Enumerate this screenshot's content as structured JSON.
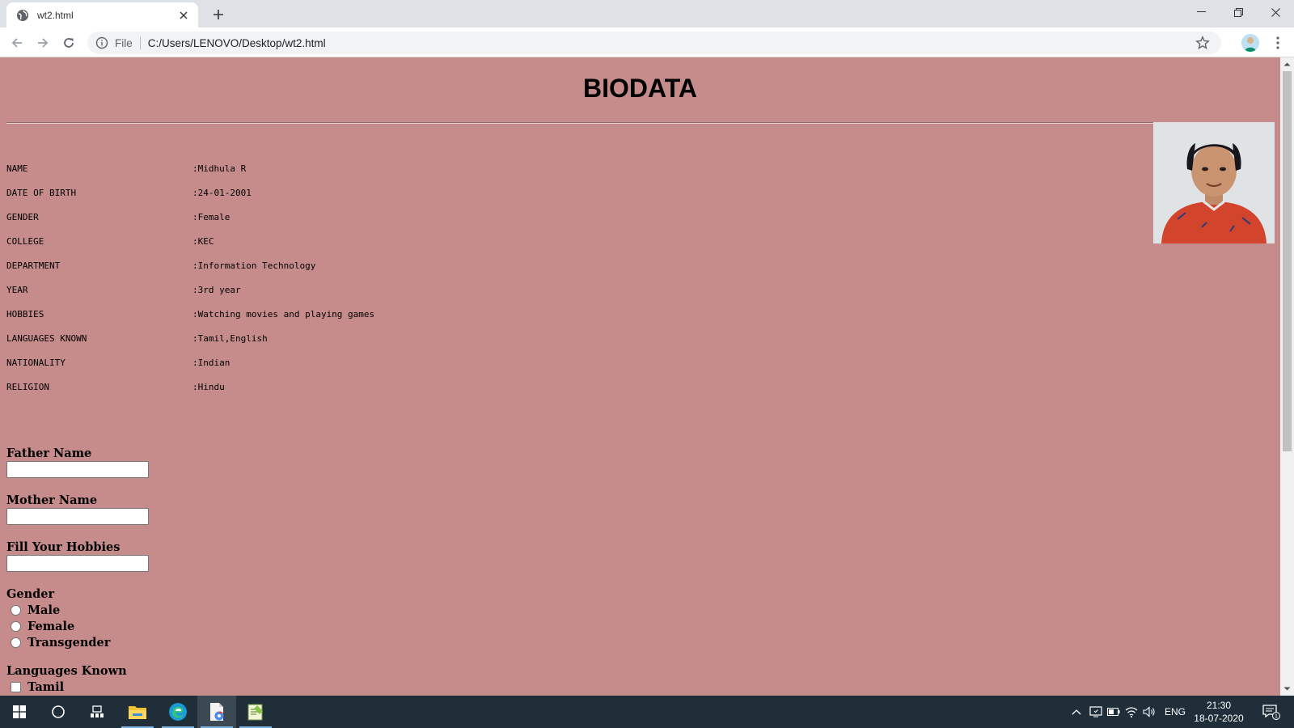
{
  "browser": {
    "tab_title": "wt2.html",
    "omnibox_scheme": "File",
    "url": "C:/Users/LENOVO/Desktop/wt2.html"
  },
  "page": {
    "heading": "BIODATA",
    "background_color": "#c68b8b",
    "info": [
      {
        "label": "NAME",
        "value": ":Midhula R"
      },
      {
        "label": "DATE OF BIRTH",
        "value": ":24-01-2001"
      },
      {
        "label": "GENDER",
        "value": ":Female"
      },
      {
        "label": "COLLEGE",
        "value": ":KEC"
      },
      {
        "label": "DEPARTMENT",
        "value": ":Information Technology"
      },
      {
        "label": "YEAR",
        "value": ":3rd year"
      },
      {
        "label": "HOBBIES",
        "value": ":Watching movies and playing games"
      },
      {
        "label": "LANGUAGES KNOWN",
        "value": ":Tamil,English"
      },
      {
        "label": "NATIONALITY",
        "value": ":Indian"
      },
      {
        "label": "RELIGION",
        "value": ":Hindu"
      }
    ],
    "form": {
      "father_label": "Father Name",
      "father_value": "",
      "mother_label": "Mother Name",
      "mother_value": "",
      "hobbies_label": "Fill Your Hobbies",
      "hobbies_value": "",
      "gender_label": "Gender",
      "gender_options": [
        "Male",
        "Female",
        "Transgender"
      ],
      "languages_label": "Languages Known",
      "language_options": [
        "Tamil"
      ]
    }
  },
  "taskbar": {
    "language": "ENG",
    "time": "21:30",
    "date": "18-07-2020",
    "notification_count": "1",
    "icons": [
      "windows-start-icon",
      "search-circle-icon",
      "task-view-icon",
      "file-explorer-icon",
      "edge-icon",
      "chrome-file-icon",
      "notepad-icon"
    ]
  }
}
